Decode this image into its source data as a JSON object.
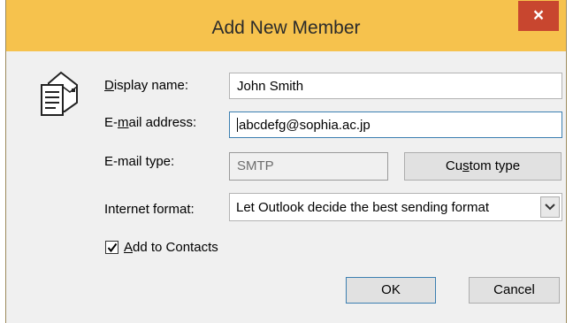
{
  "dialog": {
    "title": "Add New Member",
    "close_glyph": "×"
  },
  "fields": {
    "display_name": {
      "label_pre": "",
      "label_mn": "D",
      "label_post": "isplay name:",
      "value": "John Smith"
    },
    "email_address": {
      "label_pre": "E-",
      "label_mn": "m",
      "label_post": "ail address:",
      "value": "abcdefg@sophia.ac.jp"
    },
    "email_type": {
      "label": "E-mail type:",
      "value": "SMTP"
    },
    "internet_format": {
      "label": "Internet format:",
      "value": "Let Outlook decide the best sending format"
    }
  },
  "buttons": {
    "custom_type": {
      "pre": "Cu",
      "mn": "s",
      "post": "tom type"
    },
    "ok": "OK",
    "cancel": "Cancel"
  },
  "add_to_contacts": {
    "mn": "A",
    "post": "dd to Contacts",
    "checked": true
  },
  "icons": {
    "contact_card": "contact-card-icon",
    "close": "close-icon",
    "dropdown": "chevron-down-icon",
    "check": "checkmark-icon"
  },
  "colors": {
    "titlebar": "#f6c24d",
    "close_button": "#c8462f",
    "focus_border": "#3c7fb1"
  }
}
